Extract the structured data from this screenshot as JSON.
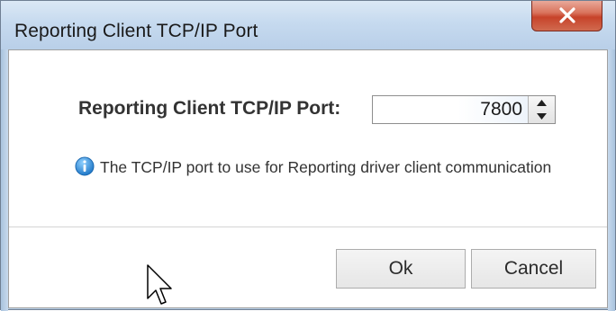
{
  "window": {
    "title": "Reporting Client TCP/IP Port",
    "close_icon": "close-x-icon"
  },
  "form": {
    "label": "Reporting Client TCP/IP Port:",
    "port_value": "7800",
    "spinner_up_icon": "arrow-up-icon",
    "spinner_down_icon": "arrow-down-icon"
  },
  "help": {
    "icon": "info-icon",
    "text": "The TCP/IP port to use for Reporting driver client communication"
  },
  "buttons": {
    "ok_label": "Ok",
    "cancel_label": "Cancel"
  },
  "colors": {
    "title_bar": "#c6daef",
    "close_button": "#c7432a",
    "info_icon": "#2a8fd8"
  }
}
